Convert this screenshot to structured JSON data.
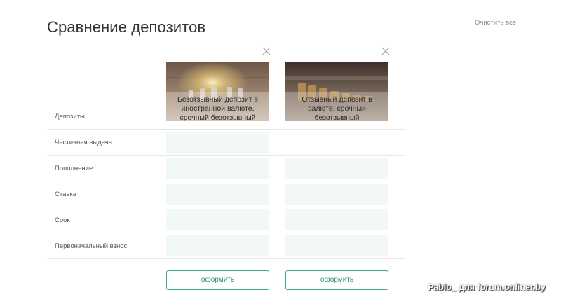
{
  "page": {
    "title": "Сравнение депозитов",
    "clear_all": "Очистить все"
  },
  "products": [
    {
      "title": "Безотзывный депозит в иностранной валюте, срочный безотзывный"
    },
    {
      "title": "Отзывный депозит в валюте, срочный безотзывный"
    }
  ],
  "rows": [
    {
      "label": "Депозиты"
    },
    {
      "label": "Частичная выдача"
    },
    {
      "label": "Пополнение"
    },
    {
      "label": "Ставка"
    },
    {
      "label": "Срок"
    },
    {
      "label": "Первоначальный взнос"
    }
  ],
  "actions": {
    "apply_label": "оформить"
  },
  "colors": {
    "accent": "#38a58c",
    "cell_bg": "#f1f8f7"
  },
  "icons": {
    "close": "close-icon"
  },
  "watermark": "Pablo_ для forum.onliner.by"
}
